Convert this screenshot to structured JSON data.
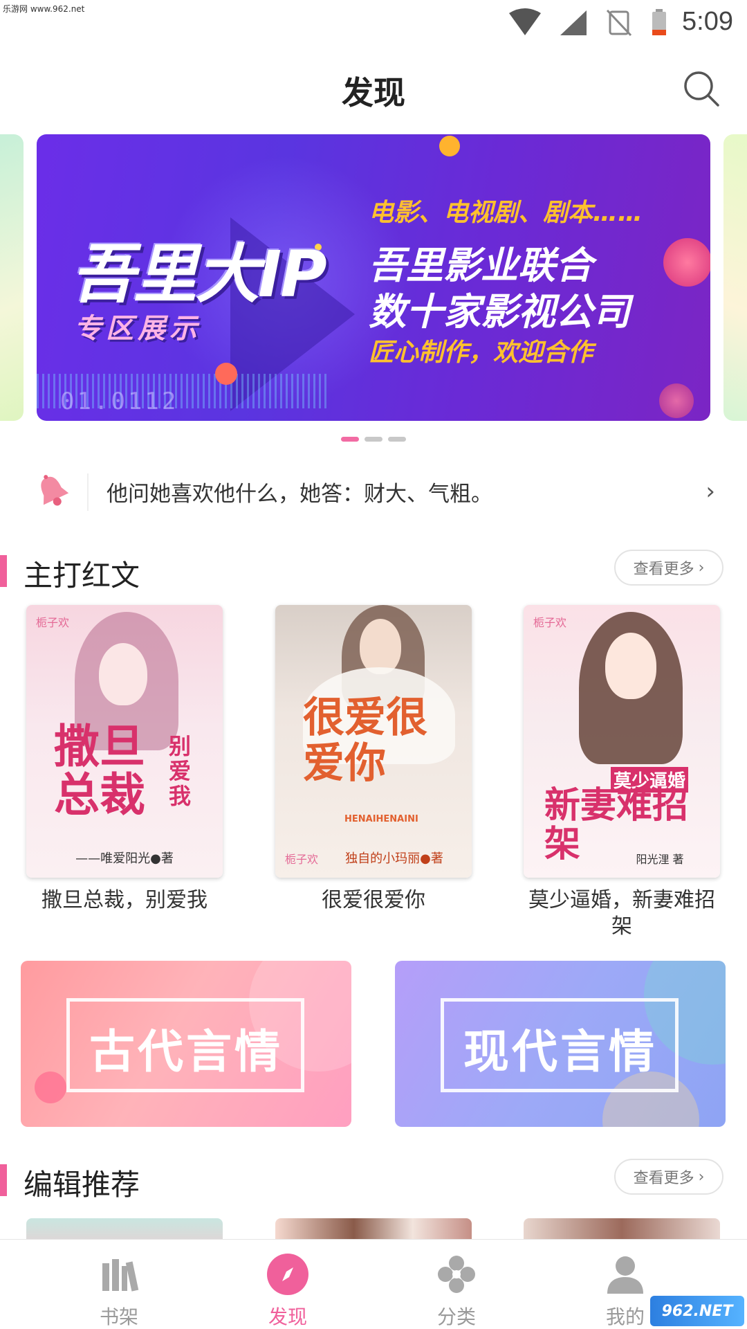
{
  "watermark": {
    "top": "乐游网 www.962.net",
    "bottom": "962.NET"
  },
  "status": {
    "time": "5:09"
  },
  "header": {
    "title": "发现"
  },
  "banner": {
    "big": "吾里大IP",
    "sub": [
      "专",
      "区",
      "展",
      "示"
    ],
    "line1": "电影、电视剧、剧本……",
    "line2": "吾里影业联合",
    "line3": "数十家影视公司",
    "line4": "匠心制作，欢迎合作",
    "code": "01.0112",
    "page_count": 3,
    "active_page": 1
  },
  "notice": {
    "text": "他问她喜欢他什么，她答：财大、气粗。"
  },
  "section_hot": {
    "title": "主打红文",
    "more": "查看更多"
  },
  "books": [
    {
      "name": "撒旦总裁，别爱我",
      "cover_title": "撒旦总裁",
      "cover_sub": "别爱我",
      "author": "——唯爱阳光●著",
      "logo": "栀子欢"
    },
    {
      "name": "很爱很爱你",
      "cover_title": "很爱很爱你",
      "cover_sub": "HENAIHENAINI",
      "author": "独自的小玛丽●著",
      "logo": "栀子欢"
    },
    {
      "name": "莫少逼婚，新妻难招架",
      "cover_title": "新妻难招架",
      "cover_sub": "莫少逼婚",
      "author": "阳光浬 著",
      "logo": "栀子欢"
    }
  ],
  "categories": [
    {
      "label": "古代言情"
    },
    {
      "label": "现代言情"
    }
  ],
  "section_editor": {
    "title": "编辑推荐",
    "more": "查看更多"
  },
  "nav": [
    {
      "label": "书架",
      "icon": "bookshelf-icon"
    },
    {
      "label": "发现",
      "icon": "compass-icon"
    },
    {
      "label": "分类",
      "icon": "category-icon"
    },
    {
      "label": "我的",
      "icon": "profile-icon"
    }
  ],
  "colors": {
    "accent": "#f0609b",
    "banner": "#6b2ee8",
    "inactive": "#9a9a9a"
  }
}
